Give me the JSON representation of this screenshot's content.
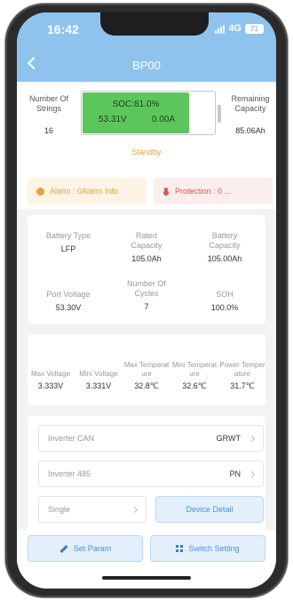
{
  "status_bar": {
    "time": "16:42",
    "network": "4G",
    "battery": "71"
  },
  "nav": {
    "title": "BP00"
  },
  "soc_panel": {
    "strings_label": "Number Of Strings",
    "strings_value": "16",
    "soc_text": "SOC:81.0%",
    "soc_fraction": 0.81,
    "voltage": "53.31V",
    "current": "0.00A",
    "remaining_label": "Remaining Capacity",
    "remaining_value": "85.06Ah",
    "state": "Standby"
  },
  "alerts": {
    "alarm_text": "Alarm : 0Alarm Info",
    "protection_text": "Protection : 0 ..."
  },
  "battery_info": [
    {
      "label": "Battery Type",
      "value": "LFP"
    },
    {
      "label": "Rated Capacity",
      "value": "105.0Ah"
    },
    {
      "label": "Battery Capacity",
      "value": "105.00Ah"
    },
    {
      "label": "Port Voltage",
      "value": "53.30V"
    },
    {
      "label": "Number Of Cycles",
      "value": "7"
    },
    {
      "label": "SOH",
      "value": "100.0%"
    }
  ],
  "cell_stats": [
    {
      "label": "Max Voltage",
      "value": "3.333V"
    },
    {
      "label": "Mini Voltage",
      "value": "3.331V"
    },
    {
      "label": "Max Temperature",
      "value": "32.8℃"
    },
    {
      "label": "Mini Temperature",
      "value": "32.6℃"
    },
    {
      "label": "Power Temperature",
      "value": "31.7℃"
    }
  ],
  "actions": {
    "inverter_can_label": "Inverter CAN",
    "inverter_can_value": "GRWT",
    "inverter_485_label": "Inverter 485",
    "inverter_485_value": "PN",
    "mode_value": "Single",
    "device_detail_label": "Device Detail"
  },
  "bottom_bar": {
    "set_param_label": "Set Param",
    "switch_setting_label": "Switch Setting"
  },
  "colors": {
    "header": "#8ec3ee",
    "soc_fill": "#5cc65c",
    "standby": "#e6a23c",
    "alarm": "#e6a23c",
    "protection": "#e05555",
    "button_accent": "#4a90d9"
  }
}
